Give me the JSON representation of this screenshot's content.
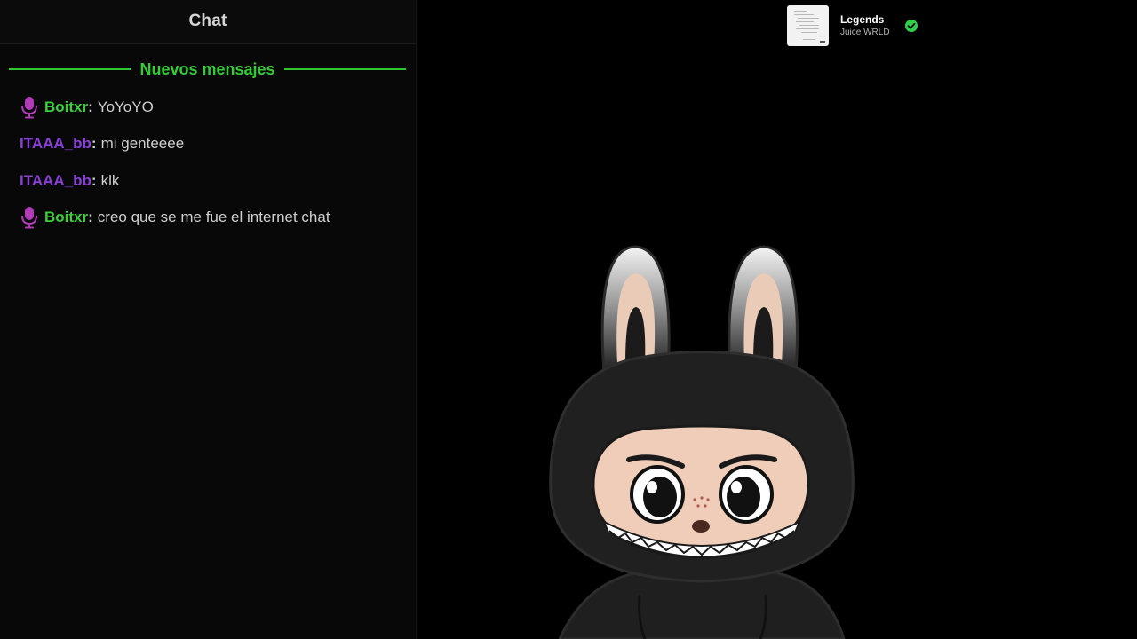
{
  "chat": {
    "title": "Chat",
    "new_messages_label": "Nuevos mensajes",
    "messages": [
      {
        "user": "Boitxr",
        "user_color": "#3ccd3c",
        "text": "YoYoYO",
        "mic_badge": true
      },
      {
        "user": "ITAAA_bb",
        "user_color": "#8a3fd9",
        "text": "mi genteeee",
        "mic_badge": false
      },
      {
        "user": "ITAAA_bb",
        "user_color": "#8a3fd9",
        "text": "klk",
        "mic_badge": false
      },
      {
        "user": "Boitxr",
        "user_color": "#3ccd3c",
        "text": "creo que se me fue el internet chat",
        "mic_badge": true
      }
    ],
    "mic_icon": "microphone-icon",
    "mic_color": "#b13bb8"
  },
  "now_playing": {
    "title": "Legends",
    "artist": "Juice WRLD",
    "status_icon": "check-circle-icon",
    "status_color": "#2fd14a"
  },
  "avatar": {
    "icon": "bunny-hood-character"
  },
  "colors": {
    "background": "#000000",
    "accent_green": "#33cc33",
    "username_purple": "#8a3fd9",
    "text": "#cfcfcf"
  }
}
